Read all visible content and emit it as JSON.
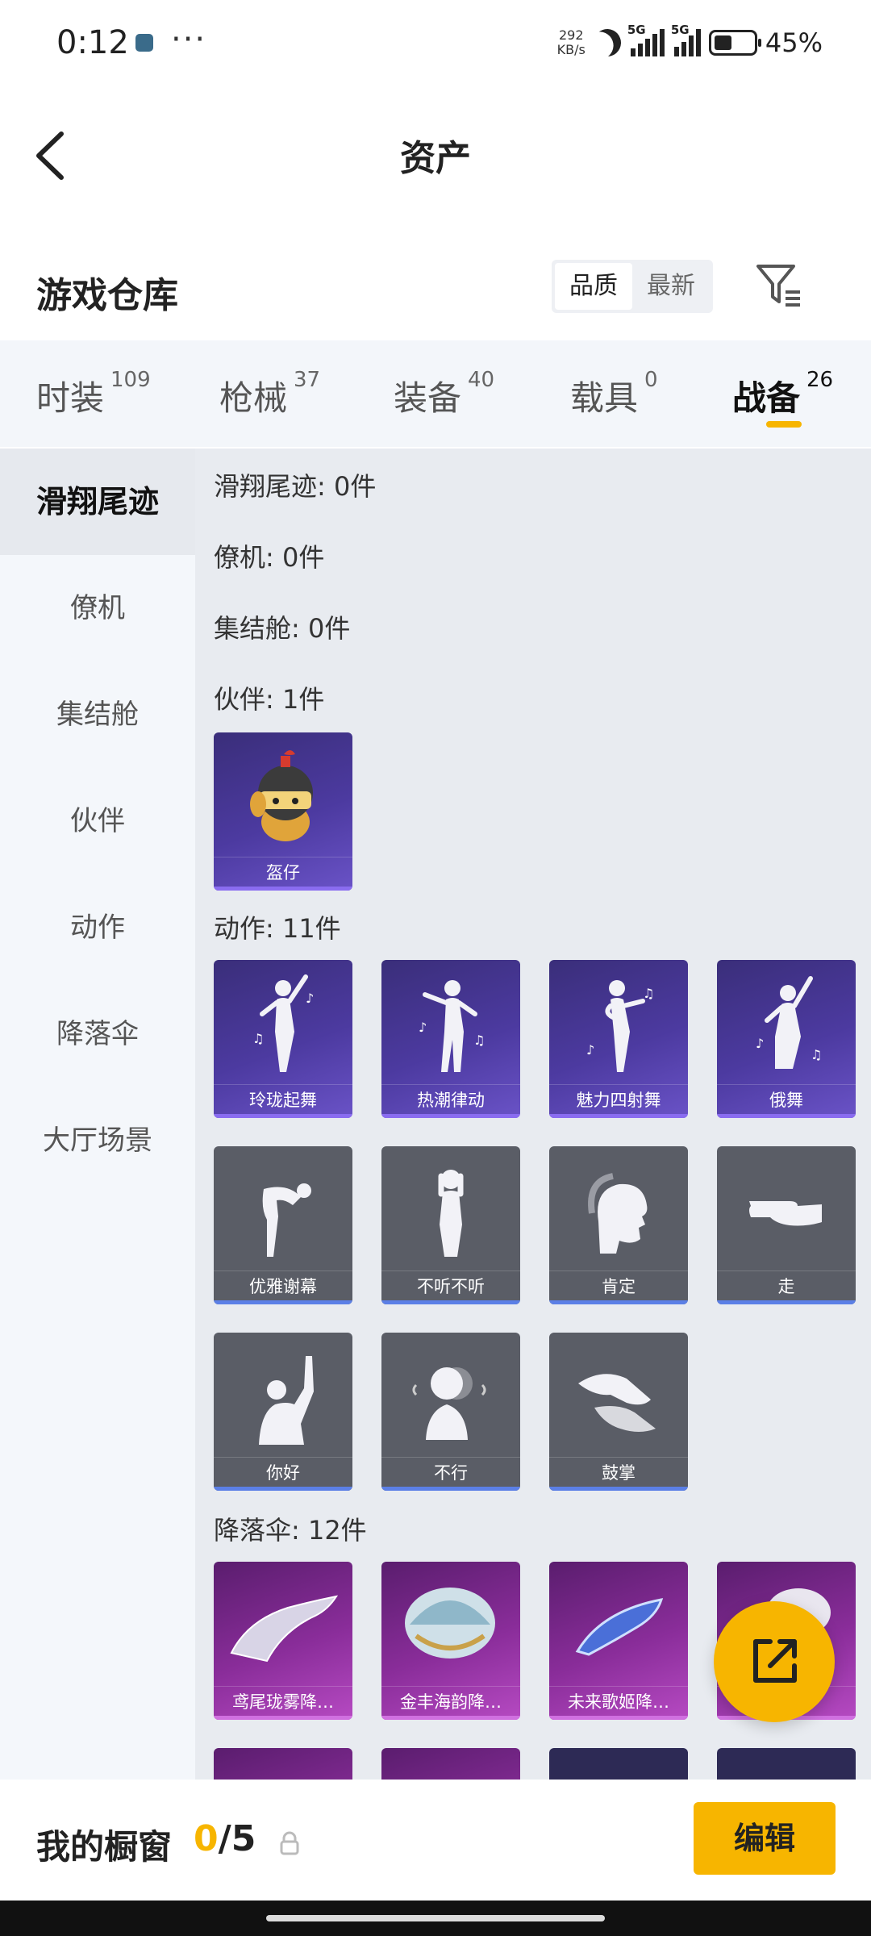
{
  "status_bar": {
    "time": "0:12",
    "net_speed_value": "292",
    "net_speed_unit": "KB/s",
    "signal_1_tag": "5G",
    "signal_2_tag": "5G",
    "battery_percent": "45%",
    "battery_level": 0.45
  },
  "header": {
    "title": "资产"
  },
  "warehouse": {
    "title": "游戏仓库",
    "sort_options": [
      "品质",
      "最新"
    ],
    "active_sort": "品质"
  },
  "tabs": [
    {
      "label": "时装",
      "count": "109"
    },
    {
      "label": "枪械",
      "count": "37"
    },
    {
      "label": "装备",
      "count": "40"
    },
    {
      "label": "载具",
      "count": "0"
    },
    {
      "label": "战备",
      "count": "26"
    }
  ],
  "active_tab": "战备",
  "sidebar": [
    "滑翔尾迹",
    "僚机",
    "集结舱",
    "伙伴",
    "动作",
    "降落伞",
    "大厅场景"
  ],
  "sections": {
    "glide_trail": "滑翔尾迹: 0件",
    "wingman": "僚机: 0件",
    "assembly_pod": "集结舱: 0件",
    "partner": "伙伴: 1件",
    "action": "动作: 11件",
    "parachute": "降落伞: 12件"
  },
  "items": {
    "partner": [
      "盔仔"
    ],
    "action_purple": [
      "玲珑起舞",
      "热潮律动",
      "魅力四射舞",
      "俄舞"
    ],
    "action_gray": [
      "优雅谢幕",
      "不听不听",
      "肯定",
      "走",
      "你好",
      "不行",
      "鼓掌"
    ],
    "parachute": [
      "鸢尾珑雾降…",
      "金丰海韵降…",
      "未来歌姬降…",
      "…"
    ]
  },
  "bottom": {
    "label": "我的橱窗",
    "count_current": "0",
    "count_total": "/5",
    "edit_label": "编辑"
  },
  "colors": {
    "accent": "#f7b500",
    "purple_card": "#4c3aa0",
    "gray_card": "#5a5d66",
    "magenta_card": "#8a2d9a"
  }
}
